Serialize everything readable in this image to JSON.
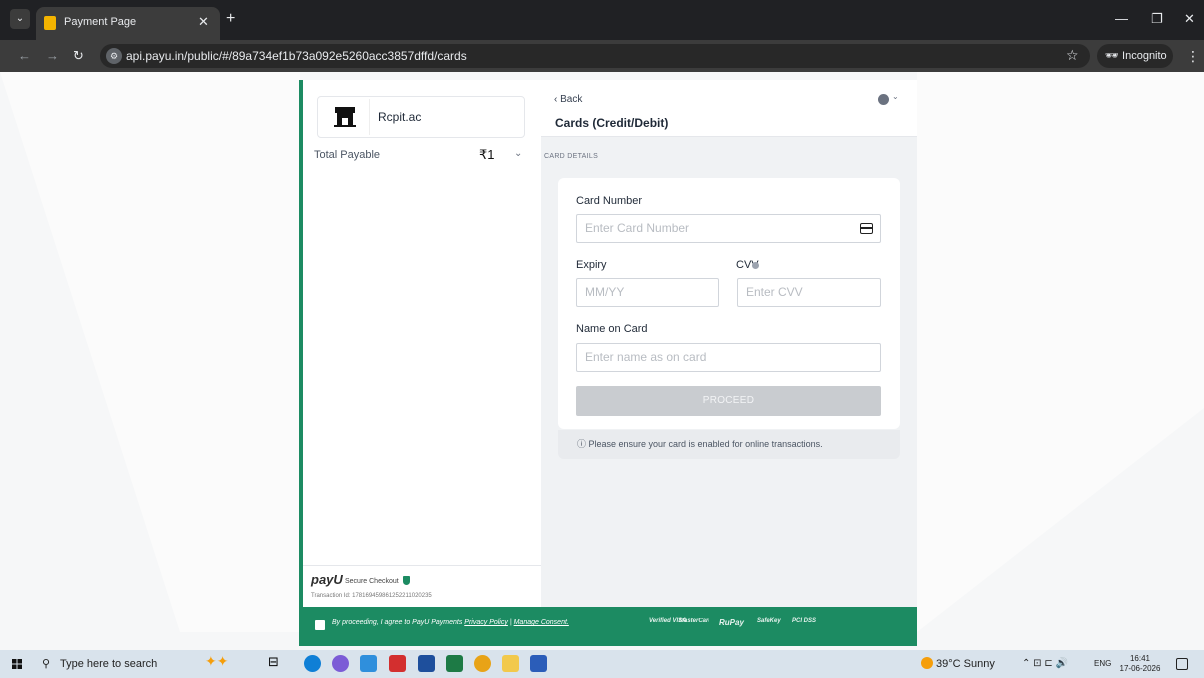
{
  "browser": {
    "tab_title": "Payment Page",
    "url": "api.payu.in/public/#/89a734ef1b73a092e5260acc3857dffd/cards",
    "incognito_label": "Incognito"
  },
  "merchant": {
    "name": "Rcpit.ac",
    "total_label": "Total Payable",
    "total_value": "₹1"
  },
  "checkout": {
    "back_label": "‹ Back",
    "title": "Cards (Credit/Debit)",
    "section_label": "CARD DETAILS",
    "card_number_label": "Card Number",
    "card_number_placeholder": "Enter Card Number",
    "expiry_label": "Expiry",
    "expiry_placeholder": "MM/YY",
    "cvv_label": "CVV",
    "cvv_placeholder": "Enter CVV",
    "name_label": "Name on Card",
    "name_placeholder": "Enter name as on card",
    "proceed_label": "PROCEED",
    "notice": "ⓘ Please ensure your card is enabled for online transactions."
  },
  "branding": {
    "payu_logo": "payU",
    "secure_label": "Secure Checkout",
    "transaction_id": "Transaction Id: 17816945986125221102023​5"
  },
  "footer": {
    "consent_prefix": "By proceeding, I agree to PayU Payments ",
    "privacy_link": "Privacy Policy",
    "separator": " | ",
    "consent_link": "Manage Consent.",
    "badges": [
      "Verified VISA",
      "MasterCard SecureCode",
      "RuPay",
      "SafeKey",
      "PCI DSS"
    ]
  },
  "taskbar": {
    "search_placeholder": "Type here to search",
    "weather": "39°C  Sunny",
    "language": "ENG",
    "time": "16:41",
    "date": "17-06-2026"
  },
  "colors": {
    "brand_green": "#1c8b62",
    "proceed_disabled": "#c9ccd0"
  }
}
